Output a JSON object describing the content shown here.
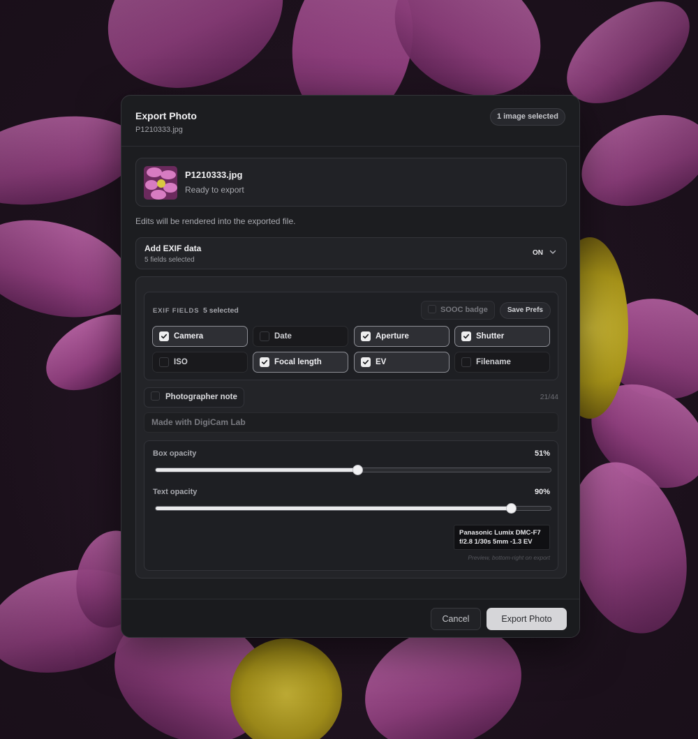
{
  "dialog": {
    "title": "Export Photo",
    "subtitle": "P1210333.jpg",
    "selection_badge": "1 image selected"
  },
  "file": {
    "name": "P1210333.jpg",
    "status": "Ready to export"
  },
  "render_note": "Edits will be rendered into the exported file.",
  "exif_toggle": {
    "title": "Add EXIF data",
    "count": "5 fields selected",
    "state": "ON"
  },
  "exif_fields": {
    "label": "EXIF FIELDS",
    "selected": "5 selected",
    "sooc_badge": "SOOC badge",
    "sooc_checked": false,
    "save_prefs": "Save Prefs",
    "items": [
      {
        "label": "Camera",
        "checked": true
      },
      {
        "label": "Date",
        "checked": false
      },
      {
        "label": "Aperture",
        "checked": true
      },
      {
        "label": "Shutter",
        "checked": true
      },
      {
        "label": "ISO",
        "checked": false
      },
      {
        "label": "Focal length",
        "checked": true
      },
      {
        "label": "EV",
        "checked": true
      },
      {
        "label": "Filename",
        "checked": false
      }
    ]
  },
  "photographer_note": {
    "label": "Photographer note",
    "checked": false,
    "char_count": "21/44",
    "value": "Made with DigiCam Lab"
  },
  "opacity": {
    "box_label": "Box opacity",
    "box_value": "51%",
    "box_level": 0.51,
    "text_label": "Text opacity",
    "text_value": "90%",
    "text_level": 0.9
  },
  "preview": {
    "line1": "Panasonic Lumix DMC-F7",
    "line2": "f/2.8 1/30s 5mm -1.3 EV",
    "caption": "Preview, bottom-right on export"
  },
  "footer": {
    "cancel": "Cancel",
    "export": "Export Photo"
  },
  "colors": {
    "dialog_bg": "#1c1d20",
    "accent_button": "#d6d6d9",
    "checkbox_on": "#eeeeef"
  }
}
